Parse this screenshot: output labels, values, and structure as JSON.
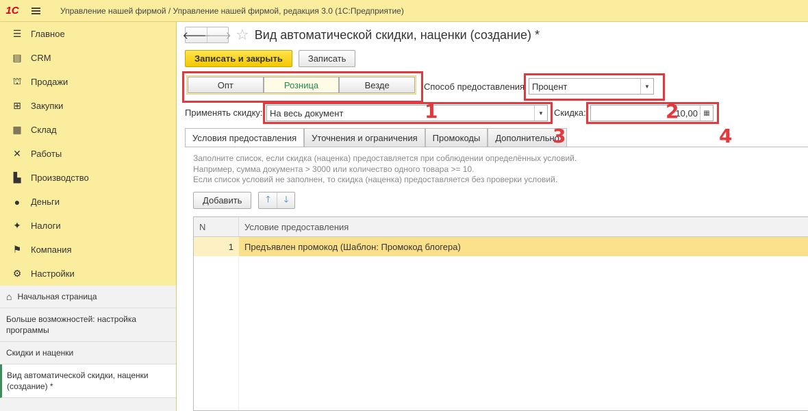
{
  "app": {
    "logo": "1С",
    "title": "Управление нашей фирмой / Управление нашей фирмой, редакция 3.0  (1С:Предприятие)"
  },
  "sidebar": {
    "sections": [
      {
        "label": "Главное",
        "icon": "menu-list-icon"
      },
      {
        "label": "CRM",
        "icon": "crm-card-icon"
      },
      {
        "label": "Продажи",
        "icon": "shopping-basket-icon"
      },
      {
        "label": "Закупки",
        "icon": "cart-icon"
      },
      {
        "label": "Склад",
        "icon": "warehouse-grid-icon"
      },
      {
        "label": "Работы",
        "icon": "tools-icon"
      },
      {
        "label": "Производство",
        "icon": "factory-icon"
      },
      {
        "label": "Деньги",
        "icon": "ruble-coin-icon"
      },
      {
        "label": "Налоги",
        "icon": "eagle-emblem-icon"
      },
      {
        "label": "Компания",
        "icon": "company-flag-icon"
      },
      {
        "label": "Настройки",
        "icon": "settings-gear-icon"
      }
    ],
    "open_windows": {
      "home": "Начальная страница",
      "more": "Больше возможностей: настройка программы",
      "discounts": "Скидки и наценки",
      "current": "Вид автоматической скидки, наценки (создание) *"
    }
  },
  "form": {
    "title": "Вид автоматической скидки, наценки (создание) *",
    "save_close_label": "Записать и закрыть",
    "save_label": "Записать",
    "segments": [
      {
        "label": "Опт",
        "selected": false
      },
      {
        "label": "Розница",
        "selected": true
      },
      {
        "label": "Везде",
        "selected": false
      }
    ],
    "method_label": "Способ предоставления",
    "method_value": "Процент",
    "apply_label": "Применять скидку:",
    "apply_value": "На весь документ",
    "discount_label": "Скидка:",
    "discount_value": "10,00",
    "tabs": [
      "Условия предоставления",
      "Уточнения и ограничения",
      "Промокоды",
      "Дополнительно"
    ],
    "hint_lines": [
      "Заполните список, если скидка (наценка) предоставляется при соблюдении определённых условий.",
      "Например, сумма документа > 3000 или количество одного товара >= 10.",
      "Если список условий не заполнен, то скидка (наценка) предоставляется без проверки условий."
    ],
    "add_label": "Добавить",
    "table": {
      "headers": [
        "N",
        "Условие предоставления"
      ],
      "rows": [
        {
          "n": "1",
          "condition": "Предъявлен промокод (Шаблон: Промокод блогера)"
        }
      ]
    }
  },
  "annotations": [
    "1",
    "2",
    "3",
    "4"
  ],
  "colors": {
    "panel": "#fbed9e",
    "primary_button": "#f3c800",
    "highlight_frame": "#e0393e",
    "selected_row": "#fbe08c",
    "selected_segment_text": "#1f8a4c"
  }
}
